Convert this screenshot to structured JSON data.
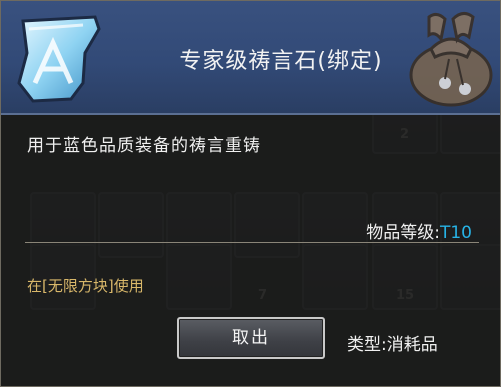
{
  "item": {
    "name": "专家级祷言石(绑定)",
    "description": "用于蓝色品质装备的祷言重铸",
    "level_label": "物品等级",
    "level_value": "T10",
    "usage": "在[无限方块]使用",
    "type_label": "类型",
    "type_value": "消耗品",
    "icon": "crystal-shard-icon",
    "decoration_icon": "loot-bag-icon"
  },
  "actions": {
    "take_out_label": "取出"
  },
  "inventory_counts": [
    "2",
    "7",
    "15"
  ],
  "colors": {
    "header": "#324a77",
    "level_value": "#27b3e6",
    "usage_text": "#d8b76a"
  }
}
